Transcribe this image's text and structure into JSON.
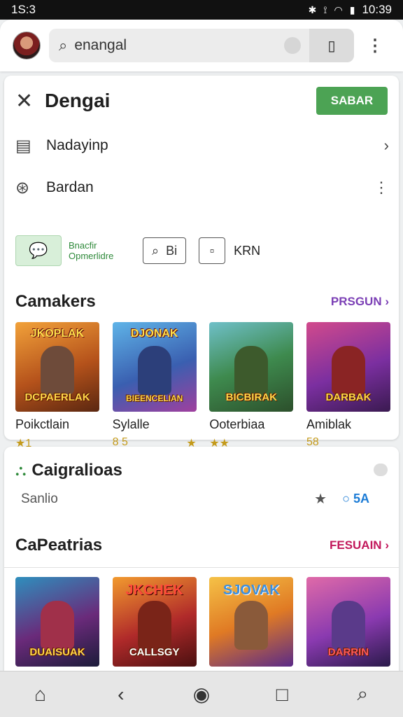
{
  "status": {
    "time": "1S:3",
    "clock": "10:39",
    "icons": [
      "bluetooth-icon",
      "vibrate-icon",
      "wifi-icon",
      "battery-icon"
    ]
  },
  "search": {
    "query": "enangal"
  },
  "header": {
    "title": "Dengai",
    "save_label": "SABAR"
  },
  "menu": [
    {
      "label": "Nadayinp",
      "icon": "list-icon",
      "trail": "chevron-right-icon"
    },
    {
      "label": "Bardan",
      "icon": "compass-icon",
      "trail": "more-vertical-icon"
    }
  ],
  "chips": {
    "green_text": "Bnacfir Opmerlidre",
    "outline_label": "Bi",
    "plain_label": "KRN"
  },
  "section1": {
    "title": "Camakers",
    "more": "PRSGUN",
    "games": [
      {
        "name": "Poikctlain",
        "rating": "1",
        "extra": "",
        "cover_top": "JKOPLAK",
        "cover_bottom": "DCPAERLAK"
      },
      {
        "name": "Sylalle",
        "rating": "8 5",
        "extra": "★",
        "cover_top": "DJONAK",
        "cover_bottom": "BIEENCELIAN"
      },
      {
        "name": "Ooterbiaa",
        "rating": "★★",
        "extra": "",
        "cover_top": "",
        "cover_bottom": "BICBIRAK"
      },
      {
        "name": "Amiblak",
        "rating": "58",
        "extra": "",
        "cover_top": "",
        "cover_bottom": "DARBAK"
      }
    ]
  },
  "category": {
    "title": "Caigralioas",
    "subtitle": "Sanlio",
    "count": "5A"
  },
  "section2": {
    "title": "CaPeatrias",
    "more": "FESUAIN",
    "games": [
      {
        "cover_top": "",
        "cover_bottom": "DUAISUAK"
      },
      {
        "cover_top": "JKCHEK",
        "cover_bottom": "CALLSGY"
      },
      {
        "cover_top": "SJOVAK",
        "cover_bottom": ""
      },
      {
        "cover_top": "",
        "cover_bottom": "DARRIN"
      }
    ]
  },
  "colors": {
    "accent_green": "#4ca354",
    "more_link": "#7b3fb5",
    "more_link_2": "#c2185b",
    "blue": "#1b7bd6"
  }
}
